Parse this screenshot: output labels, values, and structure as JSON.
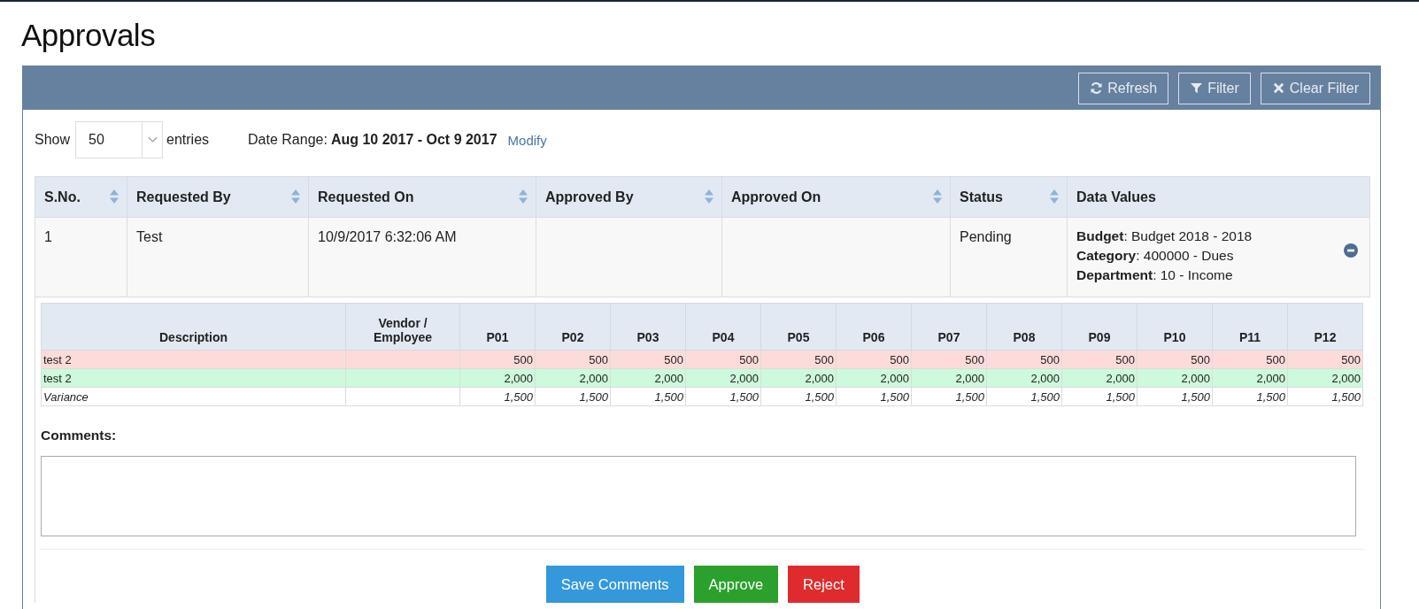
{
  "page": {
    "title": "Approvals"
  },
  "toolbar": {
    "buttons": [
      {
        "kind": "refresh",
        "label": "Refresh"
      },
      {
        "kind": "filter",
        "label": "Filter"
      },
      {
        "kind": "clear",
        "label": "Clear Filter"
      }
    ]
  },
  "controls": {
    "show_label": "Show",
    "page_size": "50",
    "entries_label": "entries",
    "date_range_label": "Date Range:",
    "date_range": "Aug 10 2017 - Oct 9 2017",
    "modify_link": "Modify"
  },
  "table": {
    "columns": [
      {
        "label": "S.No.",
        "sortable": true
      },
      {
        "label": "Requested By",
        "sortable": true
      },
      {
        "label": "Requested On",
        "sortable": true
      },
      {
        "label": "Approved By",
        "sortable": true
      },
      {
        "label": "Approved On",
        "sortable": true
      },
      {
        "label": "Status",
        "sortable": true
      },
      {
        "label": "Data Values",
        "sortable": false
      }
    ],
    "rows": [
      {
        "sno": "1",
        "requested_by": "Test",
        "requested_on": "10/9/2017 6:32:06 AM",
        "status": "Pending",
        "expanded": true,
        "data_values": [
          "**Budget**: Budget 2018 - 2018",
          "**Category**: 400000 - Dues",
          "**Department**: 10 - Income"
        ]
      }
    ]
  },
  "detail": {
    "columns": [
      "Description",
      "Vendor / Employee",
      "P01",
      "P02",
      "P03",
      "P04",
      "P05",
      "P06",
      "P07",
      "P08",
      "P09",
      "P10",
      "P11",
      "P12"
    ],
    "rows": [
      {
        "kind": "budget",
        "description": "test 2",
        "values": [
          "500",
          "500",
          "500",
          "500",
          "500",
          "500",
          "500",
          "500",
          "500",
          "500",
          "500",
          "500"
        ]
      },
      {
        "kind": "actual",
        "description": "test 2",
        "values": [
          "2,000",
          "2,000",
          "2,000",
          "2,000",
          "2,000",
          "2,000",
          "2,000",
          "2,000",
          "2,000",
          "2,000",
          "2,000",
          "2,000"
        ]
      },
      {
        "kind": "variance",
        "description": "Variance",
        "values": [
          "1,500",
          "1,500",
          "1,500",
          "1,500",
          "1,500",
          "1,500",
          "1,500",
          "1,500",
          "1,500",
          "1,500",
          "1,500",
          "1,500"
        ]
      }
    ]
  },
  "comments": {
    "label": "Comments:"
  },
  "actions": [
    {
      "kind": "save",
      "label": "Save Comments"
    },
    {
      "kind": "approve",
      "label": "Approve"
    },
    {
      "kind": "reject",
      "label": "Reject"
    }
  ]
}
